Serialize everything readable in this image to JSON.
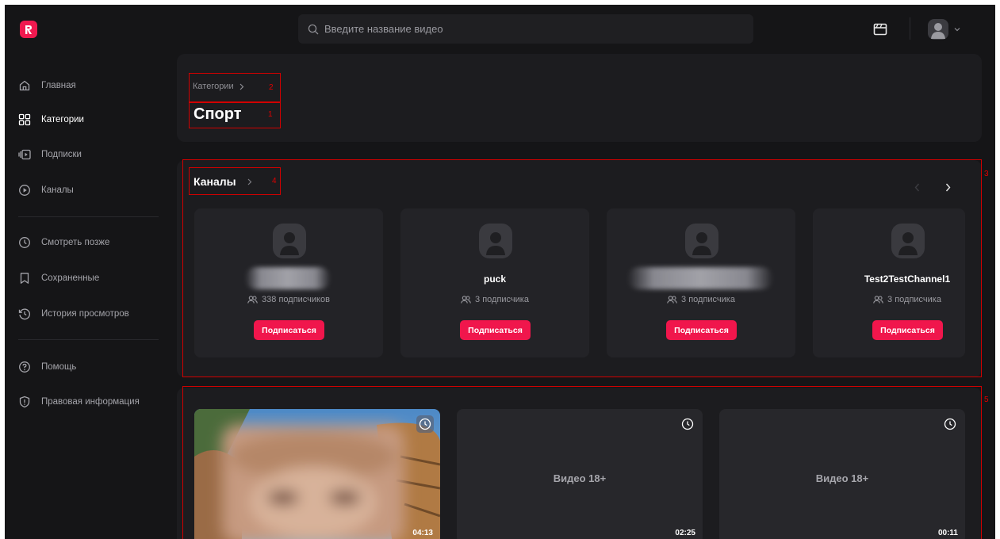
{
  "app": {
    "logo": "logo-icon"
  },
  "search": {
    "placeholder": "Введите название видео",
    "icon": "search-icon"
  },
  "header": {
    "studio_icon": "clapperboard-icon",
    "avatar_icon": "avatar-icon",
    "menu_icon": "chevron-down-icon"
  },
  "sidebar": {
    "items": [
      {
        "label": "Главная",
        "icon": "home-icon",
        "active": false
      },
      {
        "label": "Категории",
        "icon": "grid-icon",
        "active": true
      },
      {
        "label": "Подписки",
        "icon": "subscriptions-icon",
        "active": false
      },
      {
        "label": "Каналы",
        "icon": "play-circle-icon",
        "active": false
      },
      {
        "label": "Смотреть позже",
        "icon": "clock-icon",
        "active": false
      },
      {
        "label": "Сохраненные",
        "icon": "bookmark-icon",
        "active": false
      },
      {
        "label": "История просмотров",
        "icon": "history-icon",
        "active": false
      },
      {
        "label": "Помощь",
        "icon": "help-icon",
        "active": false
      },
      {
        "label": "Правовая информация",
        "icon": "shield-icon",
        "active": false
      }
    ]
  },
  "category": {
    "breadcrumb": "Категории",
    "title": "Спорт"
  },
  "channels": {
    "title": "Каналы",
    "cards": [
      {
        "name": "",
        "name_hidden": true,
        "subscribers": "338 подписчиков",
        "button": "Подписаться"
      },
      {
        "name": "puck",
        "name_hidden": false,
        "subscribers": "3 подписчика",
        "button": "Подписаться"
      },
      {
        "name": "",
        "name_hidden": true,
        "subscribers": "3 подписчика",
        "button": "Подписаться"
      },
      {
        "name": "Test2TestChannel1",
        "name_hidden": false,
        "subscribers": "3 подписчика",
        "button": "Подписаться"
      }
    ]
  },
  "videos": [
    {
      "label": "",
      "duration": "04:13",
      "thumbnail": "photo"
    },
    {
      "label": "Видео 18+",
      "duration": "02:25",
      "thumbnail": "age-restricted"
    },
    {
      "label": "Видео 18+",
      "duration": "00:11",
      "thumbnail": "age-restricted"
    }
  ],
  "annotations": [
    "1",
    "2",
    "3",
    "4",
    "5"
  ],
  "colors": {
    "accent": "#f0164c",
    "background": "#151517",
    "panel": "#1c1c1f",
    "card": "#232327",
    "annotation": "#d10000"
  }
}
